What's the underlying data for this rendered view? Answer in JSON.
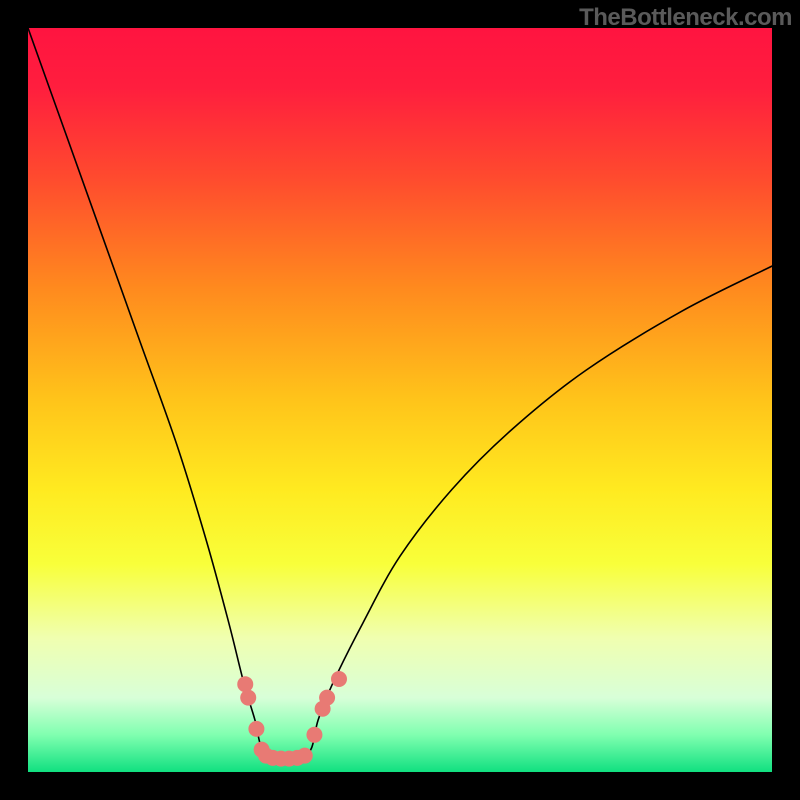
{
  "watermark": "TheBottleneck.com",
  "chart_data": {
    "type": "line",
    "title": "",
    "xlabel": "",
    "ylabel": "",
    "xlim": [
      0,
      100
    ],
    "ylim": [
      0,
      100
    ],
    "grid": false,
    "legend": false,
    "background_gradient": {
      "stops": [
        {
          "pos": 0.0,
          "color": "#ff1440"
        },
        {
          "pos": 0.08,
          "color": "#ff1e3e"
        },
        {
          "pos": 0.2,
          "color": "#ff4a2e"
        },
        {
          "pos": 0.35,
          "color": "#ff8a1e"
        },
        {
          "pos": 0.5,
          "color": "#ffc41a"
        },
        {
          "pos": 0.62,
          "color": "#ffea20"
        },
        {
          "pos": 0.72,
          "color": "#f8ff3a"
        },
        {
          "pos": 0.82,
          "color": "#f0ffb0"
        },
        {
          "pos": 0.9,
          "color": "#d8ffd8"
        },
        {
          "pos": 0.95,
          "color": "#80ffb0"
        },
        {
          "pos": 1.0,
          "color": "#10e080"
        }
      ]
    },
    "series": [
      {
        "name": "curve",
        "color": "#000000",
        "stroke_width": 1.6,
        "x": [
          0,
          5,
          10,
          15,
          20,
          24,
          27,
          29,
          30.5,
          31.5,
          33.5,
          36,
          38,
          39,
          41,
          45,
          50,
          57,
          65,
          75,
          88,
          100
        ],
        "y": [
          100,
          86,
          72,
          58,
          44,
          31,
          20,
          12,
          7,
          3,
          2,
          2,
          3,
          7,
          12,
          20,
          29,
          38,
          46,
          54,
          62,
          68
        ]
      }
    ],
    "markers": {
      "color": "#e87a74",
      "radius_px": 8,
      "points": [
        {
          "x": 29.2,
          "y": 11.8
        },
        {
          "x": 29.6,
          "y": 10.0
        },
        {
          "x": 30.7,
          "y": 5.8
        },
        {
          "x": 31.4,
          "y": 3.0
        },
        {
          "x": 32.0,
          "y": 2.2
        },
        {
          "x": 32.9,
          "y": 1.9
        },
        {
          "x": 34.0,
          "y": 1.8
        },
        {
          "x": 35.1,
          "y": 1.8
        },
        {
          "x": 36.2,
          "y": 1.9
        },
        {
          "x": 37.2,
          "y": 2.2
        },
        {
          "x": 38.5,
          "y": 5.0
        },
        {
          "x": 39.6,
          "y": 8.5
        },
        {
          "x": 40.2,
          "y": 10.0
        },
        {
          "x": 41.8,
          "y": 12.5
        }
      ]
    }
  }
}
